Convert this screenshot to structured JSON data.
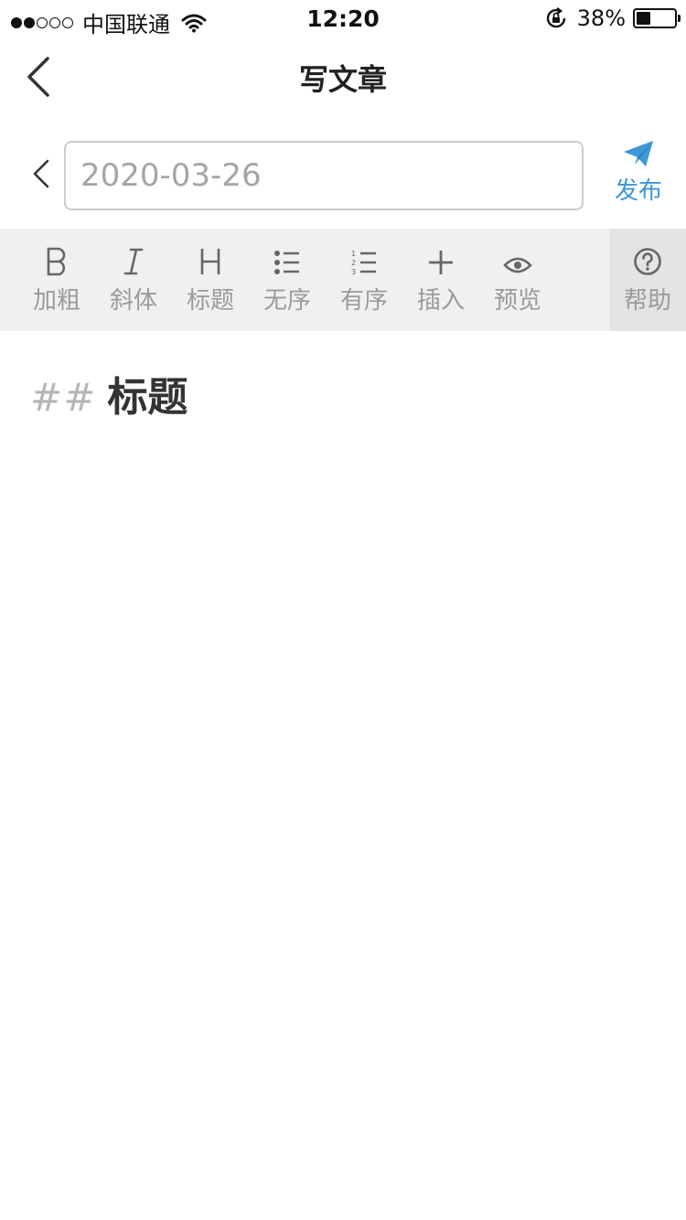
{
  "status_bar": {
    "carrier": "中国联通",
    "time": "12:20",
    "battery_percent": "38%",
    "battery_level": 0.38,
    "signal_bars_on": 2,
    "signal_bars_total": 5
  },
  "nav": {
    "title": "写文章"
  },
  "title_row": {
    "placeholder": "2020-03-26",
    "publish_label": "发布"
  },
  "toolbar": {
    "bold": "加粗",
    "italic": "斜体",
    "heading": "标题",
    "unordered": "无序",
    "ordered": "有序",
    "insert": "插入",
    "preview": "预览",
    "help": "帮助"
  },
  "editor": {
    "heading_marker": "##",
    "heading_text": "标题"
  },
  "colors": {
    "accent": "#3d97d8",
    "toolbar_bg": "#f0f0f0",
    "help_bg": "#e4e4e4",
    "hint_text": "#a5a5a5"
  },
  "icons": {
    "bold": "bold-icon",
    "italic": "italic-icon",
    "heading": "heading-icon",
    "unordered": "unordered-list-icon",
    "ordered": "ordered-list-icon",
    "insert": "plus-icon",
    "preview": "eye-icon",
    "help": "question-circle-icon",
    "publish": "paper-plane-icon"
  }
}
